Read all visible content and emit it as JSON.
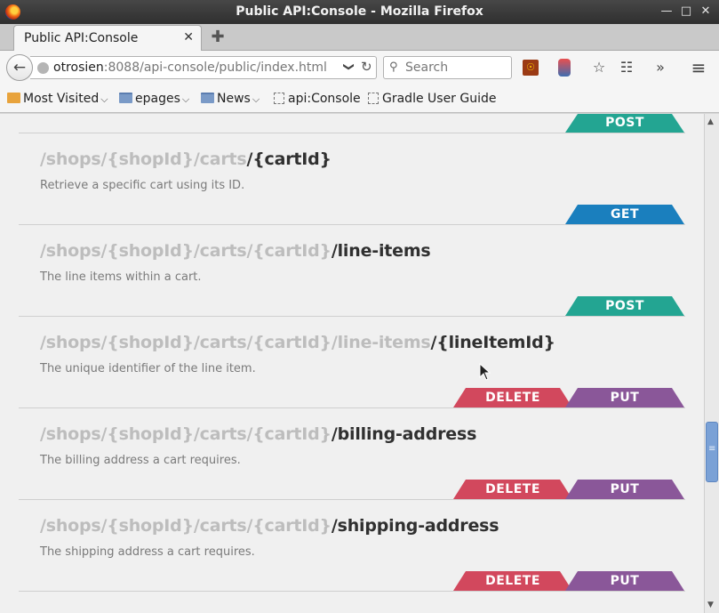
{
  "window": {
    "title": "Public API:Console - Mozilla Firefox",
    "controls": {
      "minimize": "—",
      "maximize": "□",
      "close": "✕"
    }
  },
  "tabs": [
    {
      "label": "Public API:Console",
      "close": "✕"
    }
  ],
  "newtab": "✚",
  "nav": {
    "back": "←",
    "url_host": "otrosien",
    "url_rest": ":8088/api-console/public/index.html",
    "url_dropdown": "❯",
    "reload": "↻",
    "search_placeholder": "Search",
    "search_icon": "⚲",
    "bookmark_star": "☆",
    "reader": "☷",
    "overflow": "»",
    "menu": "≡",
    "ext1": "☉"
  },
  "bookmarks": [
    {
      "label": "Most Visited",
      "kind": "mv",
      "chevron": "⌄"
    },
    {
      "label": "epages",
      "kind": "folder",
      "chevron": "⌄"
    },
    {
      "label": "News",
      "kind": "folder",
      "chevron": "⌄"
    },
    {
      "label": "api:Console",
      "kind": "page"
    },
    {
      "label": "Gradle User Guide",
      "kind": "page"
    }
  ],
  "colors": {
    "post": "#23a592",
    "get": "#1a7fbe",
    "delete": "#d2485d",
    "put": "#8a5799"
  },
  "endpoints": [
    {
      "prefix": "/shops/{shopId}/carts",
      "last": "/{cartId}",
      "description": "Retrieve a specific cart using its ID.",
      "methods": [
        "GET"
      ]
    },
    {
      "prefix": "/shops/{shopId}/carts/{cartId}",
      "last": "/line-items",
      "description": "The line items within a cart.",
      "methods": [
        "POST"
      ]
    },
    {
      "prefix": "/shops/{shopId}/carts/{cartId}/line-items",
      "last": "/{lineItemId}",
      "description": "The unique identifier of the line item.",
      "methods": [
        "DELETE",
        "PUT"
      ]
    },
    {
      "prefix": "/shops/{shopId}/carts/{cartId}",
      "last": "/billing-address",
      "description": "The billing address a cart requires.",
      "methods": [
        "DELETE",
        "PUT"
      ]
    },
    {
      "prefix": "/shops/{shopId}/carts/{cartId}",
      "last": "/shipping-address",
      "description": "The shipping address a cart requires.",
      "methods": [
        "DELETE",
        "PUT"
      ]
    }
  ],
  "top_method": "POST",
  "scrollbar": {
    "up": "▲",
    "down": "▼",
    "grip": "≡"
  }
}
